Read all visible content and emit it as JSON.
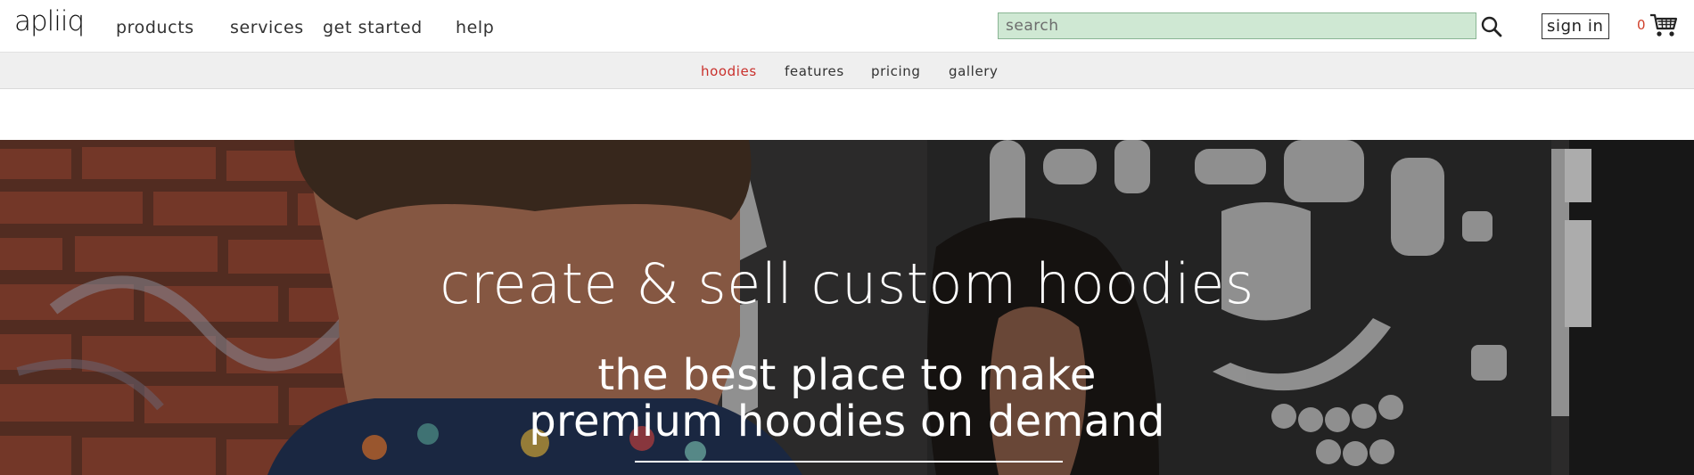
{
  "brand": {
    "logo_text": "apliiq"
  },
  "nav": {
    "products": "products",
    "services": "services",
    "get_started": "get started",
    "help": "help"
  },
  "search": {
    "placeholder": "search",
    "value": ""
  },
  "account": {
    "sign_in": "sign in"
  },
  "cart": {
    "count": "0"
  },
  "subnav": {
    "hoodies": "hoodies",
    "features": "features",
    "pricing": "pricing",
    "gallery": "gallery",
    "active": "hoodies"
  },
  "hero": {
    "title": "create & sell custom hoodies",
    "subtitle_line1": "the best place to make",
    "subtitle_line2": "premium hoodies on demand"
  },
  "colors": {
    "accent": "#c9302c",
    "search_bg": "#cfe8d3",
    "subnav_bg": "#efefef"
  }
}
